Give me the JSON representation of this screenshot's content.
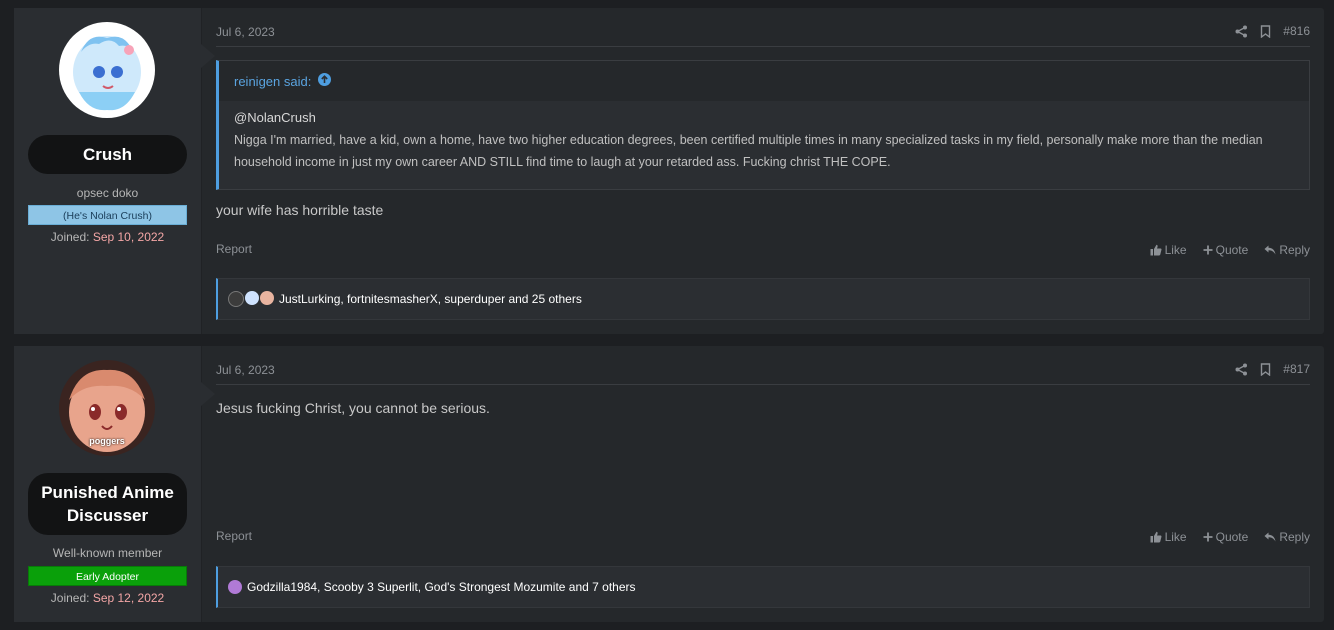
{
  "posts": [
    {
      "author": "Crush",
      "user_title": "opsec doko",
      "banner": "(He's Nolan Crush)",
      "joined_label": "Joined:",
      "joined_date": "Sep 10, 2022",
      "date": "Jul 6, 2023",
      "post_number": "#816",
      "quote_author": "reinigen said:",
      "quote_mention": "@NolanCrush",
      "quote_text": "Nigga I'm married, have a kid, own a home, have two higher education degrees, been certified multiple times in many specialized tasks in my field, personally make more than the median household income in just my own career AND STILL find time to laugh at your retarded ass. Fucking christ THE COPE.",
      "message": "your wife has horrible taste",
      "report": "Report",
      "like": "Like",
      "quote": "Quote",
      "reply": "Reply",
      "reactions": "JustLurking, fortnitesmasherX, superduper and 25 others"
    },
    {
      "author": "Punished Anime Discusser",
      "avatar_text": "poggers",
      "user_title": "Well-known member",
      "banner": "Early Adopter",
      "joined_label": "Joined:",
      "joined_date": "Sep 12, 2022",
      "date": "Jul 6, 2023",
      "post_number": "#817",
      "message": "Jesus fucking Christ, you cannot be serious.",
      "report": "Report",
      "like": "Like",
      "quote": "Quote",
      "reply": "Reply",
      "reactions": "Godzilla1984, Scooby 3 Superlit, God's Strongest Mozumite and 7 others"
    }
  ],
  "colors": {
    "accent": "#4e9ee0",
    "joined_date": "#f4a6a6",
    "banner_blue": "#8ec5e6",
    "banner_green": "#0aa00a"
  }
}
